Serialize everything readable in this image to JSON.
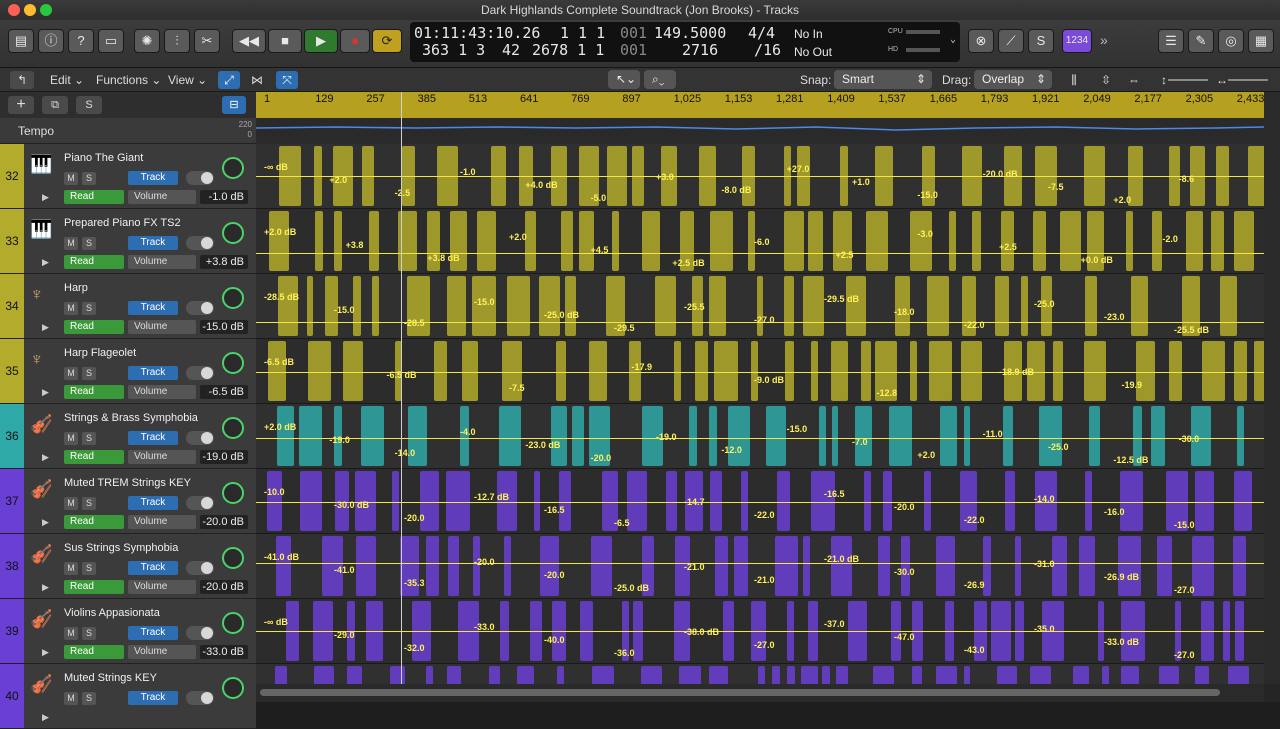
{
  "window": {
    "title": "Dark Highlands Complete Soundtrack (Jon Brooks) - Tracks"
  },
  "control_bar": {
    "lcd": {
      "smpte": "01:11:43:10.26",
      "bars": "363  1  3",
      "bars_sub": "42",
      "sub1": "1  1  1",
      "sub2": "2678  1  1",
      "sub3": "001",
      "sub4": "001",
      "tempo": "149.5000",
      "tempo_sub": "2716",
      "signature": "4/4",
      "division": "/16",
      "in": "No In",
      "out": "No Out",
      "cpu_label": "CPU",
      "hd_label": "HD"
    },
    "counter_badge": "1234"
  },
  "toolbar": {
    "edit": "Edit",
    "functions": "Functions",
    "view": "View",
    "snap_label": "Snap:",
    "snap_value": "Smart",
    "drag_label": "Drag:",
    "drag_value": "Overlap"
  },
  "tempo": {
    "label": "Tempo",
    "top": "220",
    "bottom": "0"
  },
  "ruler": {
    "marks": [
      "1",
      "129",
      "257",
      "385",
      "513",
      "641",
      "769",
      "897",
      "1,025",
      "1,153",
      "1,281",
      "1,409",
      "1,537",
      "1,665",
      "1,793",
      "1,921",
      "2,049",
      "2,177",
      "2,305",
      "2,433"
    ]
  },
  "tracks": [
    {
      "num": "32",
      "name": "Piano The Giant",
      "mode": "Read",
      "param": "Volume",
      "db": "-1.0 dB",
      "color": "#b3ab2c",
      "region_color": "#b3ab2c",
      "icon": "piano-icon"
    },
    {
      "num": "33",
      "name": "Prepared Piano FX TS2",
      "mode": "Read",
      "param": "Volume",
      "db": "+3.8 dB",
      "color": "#b3ab2c",
      "region_color": "#b3ab2c",
      "icon": "piano-icon"
    },
    {
      "num": "34",
      "name": "Harp",
      "mode": "Read",
      "param": "Volume",
      "db": "-15.0 dB",
      "color": "#b3ab2c",
      "region_color": "#b3ab2c",
      "icon": "harp-icon"
    },
    {
      "num": "35",
      "name": "Harp Flageolet",
      "mode": "Read",
      "param": "Volume",
      "db": "-6.5 dB",
      "color": "#b3ab2c",
      "region_color": "#b3ab2c",
      "icon": "harp-icon"
    },
    {
      "num": "36",
      "name": "Strings & Brass Symphobia",
      "mode": "Read",
      "param": "Volume",
      "db": "-19.0 dB",
      "color": "#2fa8a8",
      "region_color": "#2fa8a8",
      "icon": "strings-icon"
    },
    {
      "num": "37",
      "name": "Muted TREM Strings KEY",
      "mode": "Read",
      "param": "Volume",
      "db": "-20.0 dB",
      "color": "#6a3fd4",
      "region_color": "#6a3fd4",
      "icon": "strings-icon"
    },
    {
      "num": "38",
      "name": "Sus Strings Symphobia",
      "mode": "Read",
      "param": "Volume",
      "db": "-20.0 dB",
      "color": "#6a3fd4",
      "region_color": "#6a3fd4",
      "icon": "strings-icon"
    },
    {
      "num": "39",
      "name": "Violins Appasionata",
      "mode": "Read",
      "param": "Volume",
      "db": "-33.0 dB",
      "color": "#6a3fd4",
      "region_color": "#6a3fd4",
      "icon": "strings-icon"
    },
    {
      "num": "40",
      "name": "Muted Strings KEY",
      "mode": "Read",
      "param": "Volume",
      "db": "",
      "color": "#6a3fd4",
      "region_color": "#6a3fd4",
      "icon": "strings-icon"
    }
  ],
  "lane_labels": [
    [
      "-∞ dB",
      "+2.0",
      "-2.5",
      "-1.0",
      "+4.0 dB",
      "-5.0",
      "+3.0",
      "-8.0 dB",
      "+27.0",
      "+1.0",
      "-15.0",
      "-20.0 dB",
      "-7.5",
      "+2.0",
      "-8.6"
    ],
    [
      "+2.0 dB",
      "+3.8",
      "+3.8 dB",
      "+2.0",
      "+4.5",
      "+2.5 dB",
      "-6.0",
      "+2.5",
      "-3.0",
      "+2.5",
      "+0.0 dB",
      "-2.0"
    ],
    [
      "-28.5 dB",
      "-15.0",
      "-28.5",
      "-15.0",
      "-25.0 dB",
      "-29.5",
      "-25.5",
      "-27.0",
      "-29.5 dB",
      "-18.0",
      "-22.0",
      "-25.0",
      "-23.0",
      "-25.5 dB"
    ],
    [
      "-6.5 dB",
      "-6.5 dB",
      "-7.5",
      "-17.9",
      "-9.0 dB",
      "-12.8",
      "-18.9 dB",
      "-19.9"
    ],
    [
      "+2.0 dB",
      "-19.0",
      "-14.0",
      "-4.0",
      "-23.0 dB",
      "-20.0",
      "-19.0",
      "-12.0",
      "-15.0",
      "-7.0",
      "+2.0",
      "-11.0",
      "-25.0",
      "-12.5 dB",
      "-30.0"
    ],
    [
      "-10.0",
      "-30.0 dB",
      "-20.0",
      "-12.7 dB",
      "-16.5",
      "-6.5",
      "-14.7",
      "-22.0",
      "-16.5",
      "-20.0",
      "-22.0",
      "-14.0",
      "-16.0",
      "-15.0"
    ],
    [
      "-41.0 dB",
      "-41.0",
      "-35.3",
      "-20.0",
      "-20.0",
      "-25.0 dB",
      "-21.0",
      "-21.0",
      "-21.0 dB",
      "-30.0",
      "-26.9",
      "-31.0",
      "-26.9 dB",
      "-27.0"
    ],
    [
      "-∞ dB",
      "-29.0",
      "-32.0",
      "-33.0",
      "-40.0",
      "-36.0",
      "-38.0 dB",
      "-27.0",
      "-37.0",
      "-47.0",
      "-43.0",
      "-35.0",
      "-33.0 dB",
      "-27.0"
    ],
    []
  ]
}
